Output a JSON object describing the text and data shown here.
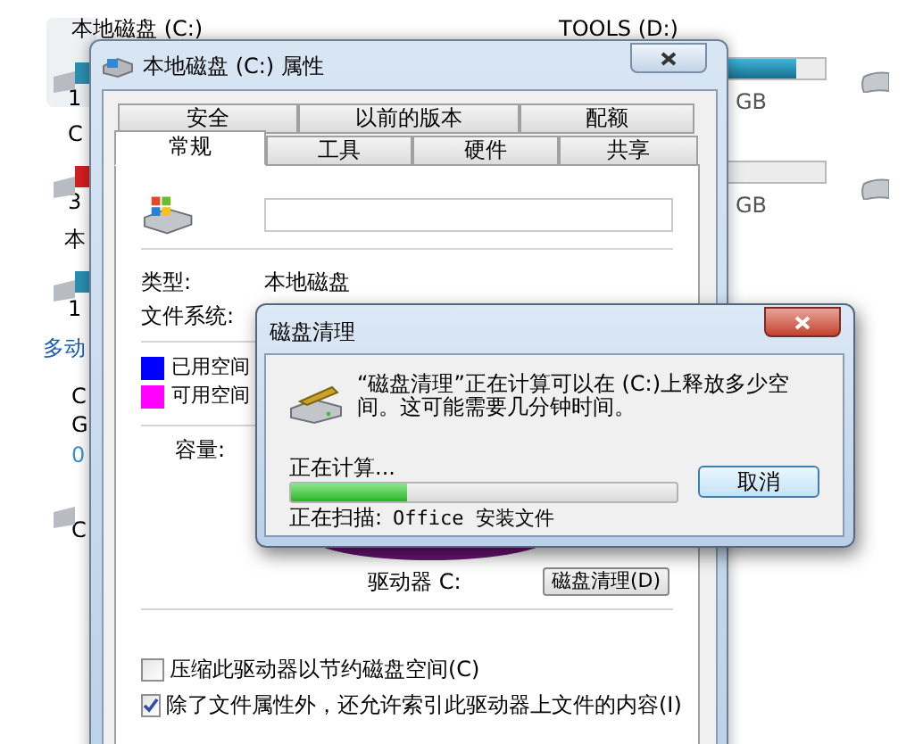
{
  "explorer": {
    "top_labels": [
      "本地磁盘 (C:)",
      "TOOLS (D:)"
    ],
    "left_fragments": [
      "1",
      "C",
      "3",
      "本",
      "1",
      "多动",
      "C",
      "G",
      "0",
      "C"
    ],
    "left_bars": [
      {
        "color": "#2a8fb0"
      },
      {
        "color": "#d42020"
      },
      {
        "color": "#2a8fb0"
      }
    ],
    "right_bars": [
      {
        "level": 0.75,
        "reading": "GB"
      },
      {
        "level": 0,
        "reading": "GB"
      }
    ]
  },
  "properties": {
    "title": "本地磁盘 (C:) 属性",
    "tabs_row1": [
      {
        "label": "安全",
        "selected": false
      },
      {
        "label": "以前的版本",
        "selected": false
      },
      {
        "label": "配额",
        "selected": false
      }
    ],
    "tabs_row2": [
      {
        "label": "常规",
        "selected": true
      },
      {
        "label": "工具",
        "selected": false
      },
      {
        "label": "硬件",
        "selected": false
      },
      {
        "label": "共享",
        "selected": false
      }
    ],
    "fields": [
      {
        "label": "类型:",
        "value": "本地磁盘"
      },
      {
        "label": "文件系统:"
      }
    ],
    "legend": [
      {
        "label": "已用空间",
        "color": "#0000ff"
      },
      {
        "label": "可用空间",
        "color": "#ff00ff"
      }
    ],
    "capacity_label": "容量:",
    "drive_label": "驱动器 C:",
    "cleanup_button": "磁盘清理(D)",
    "options": [
      {
        "label": "压缩此驱动器以节约磁盘空间(C)",
        "checked": false
      },
      {
        "label": "除了文件属性外，还允许索引此驱动器上文件的内容(I)",
        "checked": true
      }
    ]
  },
  "cleanup": {
    "title": "磁盘清理",
    "message": "“磁盘清理”正在计算可以在 (C:)上释放多少空间。这可能需要几分钟时间。",
    "status": "正在计算...",
    "progress": {
      "level": 0.3
    },
    "cancel_button": "取消",
    "scanning_label": "正在扫描:",
    "scanning_value": "Office 安装文件"
  }
}
